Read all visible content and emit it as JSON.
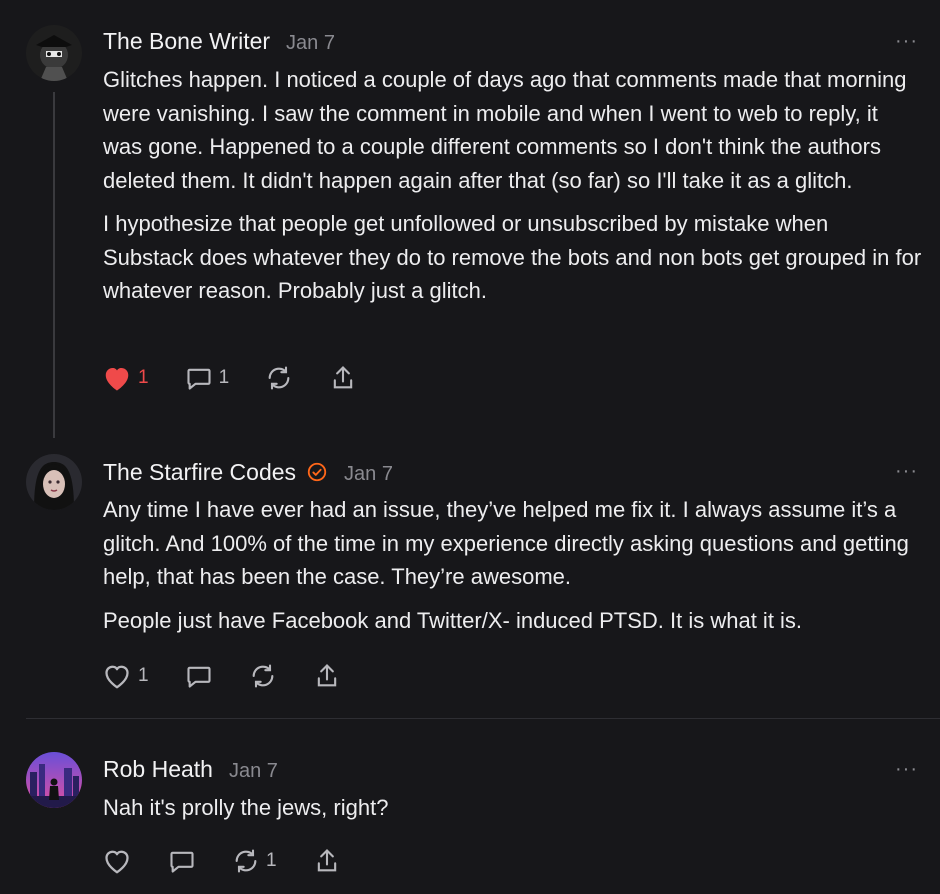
{
  "comments": [
    {
      "author": "The Bone Writer",
      "date": "Jan 7",
      "paragraphs": [
        "Glitches happen. I noticed a couple of days ago that comments made that morning were vanishing. I saw the comment in mobile and when I went to web to reply, it was gone. Happened to a couple different comments so I don't think the authors deleted them. It didn't happen again after that (so far) so I'll take it as a glitch.",
        "I hypothesize that people get unfollowed or unsubscribed by mistake when Substack does whatever they do to remove the bots and non bots get grouped in for whatever reason. Probably just a glitch."
      ],
      "like_count": "1",
      "liked": true,
      "reply_count": "1",
      "restack_count": "",
      "more_label": "···"
    },
    {
      "author": "The Starfire Codes",
      "date": "Jan 7",
      "verified": true,
      "paragraphs": [
        "Any time I have ever had an issue, they’ve helped me fix it. I always assume it’s a glitch. And 100% of the time in my experience directly asking questions and getting help, that has been the case. They’re awesome.",
        "People just have Facebook and Twitter/X- induced PTSD. It is what it is."
      ],
      "like_count": "1",
      "liked": false,
      "reply_count": "",
      "restack_count": "",
      "more_label": "···"
    },
    {
      "author": "Rob Heath",
      "date": "Jan 7",
      "paragraphs": [
        "Nah it's prolly the jews, right?"
      ],
      "like_count": "",
      "liked": false,
      "reply_count": "",
      "restack_count": "1",
      "more_label": "···"
    }
  ],
  "colors": {
    "background": "#17171a",
    "like_active": "#ef4a4a",
    "verified_badge": "#ff6719"
  }
}
